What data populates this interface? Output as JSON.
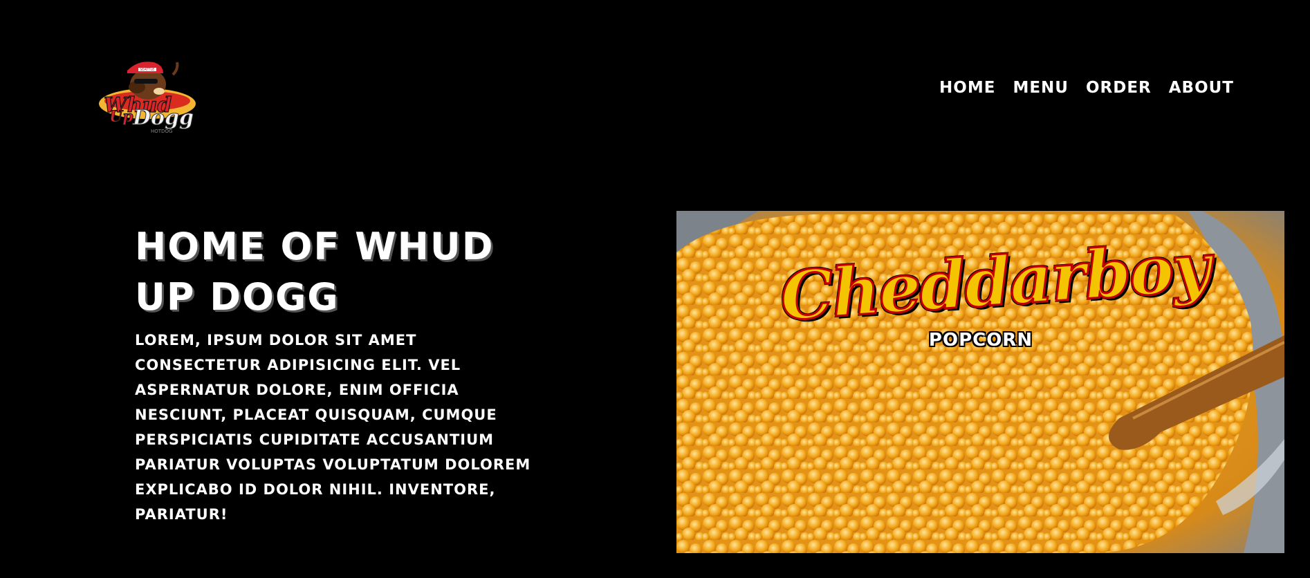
{
  "header": {
    "logo": {
      "cap_text": "SEATTLE",
      "script_text_1": "Whud",
      "script_text_2": "Up",
      "script_text_3": "Dogg",
      "tagline": "HOTDOG"
    },
    "nav": {
      "items": [
        {
          "label": "HOME"
        },
        {
          "label": "MENU"
        },
        {
          "label": "ORDER"
        },
        {
          "label": "ABOUT"
        }
      ]
    }
  },
  "hero": {
    "title": "HOME OF WHUD UP DOGG",
    "body": "LOREM, IPSUM DOLOR SIT AMET CONSECTETUR ADIPISICING ELIT. VEL ASPERNATUR DOLORE, ENIM OFFICIA NESCIUNT, PLACEAT QUISQUAM, CUMQUE PERSPICIATIS CUPIDITATE ACCUSANTIUM PARIATUR VOLUPTAS VOLUPTATUM DOLOREM EXPLICABO ID DOLOR NIHIL. INVENTORE, PARIATUR!",
    "image": {
      "brand": "Cheddarboy",
      "subtitle": "POPCORN"
    }
  },
  "colors": {
    "background": "#000000",
    "text": "#ffffff",
    "popcorn": "#f2a516",
    "brand_red": "#c40000",
    "brand_yellow": "#f5c400"
  }
}
